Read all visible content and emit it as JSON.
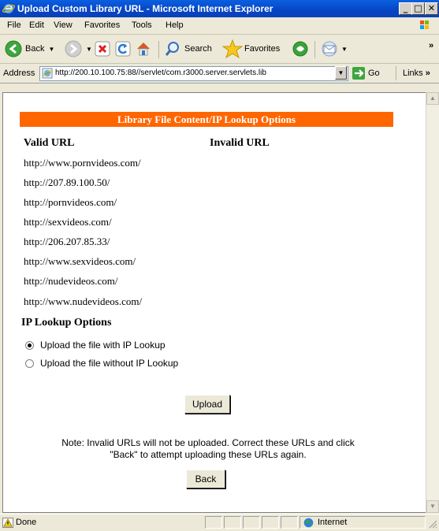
{
  "window": {
    "title": "Upload Custom Library URL - Microsoft Internet Explorer"
  },
  "menu": [
    "File",
    "Edit",
    "View",
    "Favorites",
    "Tools",
    "Help"
  ],
  "toolbar": {
    "back": "Back",
    "search": "Search",
    "favorites": "Favorites"
  },
  "address": {
    "label": "Address",
    "url": "http://200.10.100.75:88//servlet/com.r3000.server.servlets.lib",
    "go": "Go",
    "links": "Links"
  },
  "content": {
    "header": "Library File Content/IP Lookup Options",
    "valid_label": "Valid URL",
    "invalid_label": "Invalid URL",
    "valid_urls": [
      "http://www.pornvideos.com/",
      "http://207.89.100.50/",
      "http://pornvideos.com/",
      "http://sexvideos.com/",
      "http://206.207.85.33/",
      "http://www.sexvideos.com/",
      "http://nudevideos.com/",
      "http://www.nudevideos.com/"
    ],
    "ip_lookup_label": "IP Lookup Options",
    "options": [
      {
        "label": "Upload the file with IP Lookup",
        "selected": true
      },
      {
        "label": "Upload the file without IP Lookup",
        "selected": false
      }
    ],
    "upload_button": "Upload",
    "note_line1": "Note: Invalid URLs will not be uploaded. Correct these URLs and click",
    "note_line2": "\"Back\" to attempt uploading these URLs again.",
    "back_button": "Back"
  },
  "status": {
    "text": "Done",
    "zone": "Internet"
  },
  "colors": {
    "header_bg": "#ff6600",
    "title_bar": "#0745c4"
  }
}
